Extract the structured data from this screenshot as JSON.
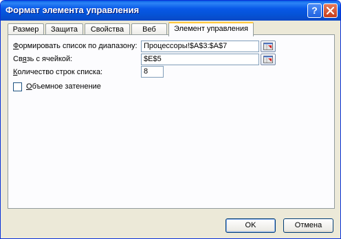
{
  "window": {
    "title": "Формат элемента управления"
  },
  "tabs": [
    {
      "label": "Размер",
      "active": false
    },
    {
      "label": "Защита",
      "active": false
    },
    {
      "label": "Свойства",
      "active": false
    },
    {
      "label": "Веб",
      "active": false
    },
    {
      "label": "Элемент управления",
      "active": true
    }
  ],
  "form": {
    "range": {
      "label_accel": "Ф",
      "label_rest": "ормировать список по диапазону:",
      "value": "Процессоры!$A$3:$A$7"
    },
    "link": {
      "label_pre": "Св",
      "label_accel": "я",
      "label_rest": "зь с ячейкой:",
      "value": "$E$5"
    },
    "rows": {
      "label_accel": "К",
      "label_rest": "оличество строк списка:",
      "value": "8"
    },
    "shading": {
      "label_accel": "О",
      "label_rest": "бъемное затенение",
      "checked": false
    }
  },
  "buttons": {
    "ok": "OK",
    "cancel": "Отмена"
  },
  "icons": {
    "help": "help-icon",
    "close": "close-icon",
    "range_picker": "collapse-dialog-icon"
  },
  "colors": {
    "title_bar": "#0858e8",
    "dialog_face": "#ece9d8",
    "active_tab_accent": "#ffc83c",
    "close_button": "#c63d1b"
  }
}
